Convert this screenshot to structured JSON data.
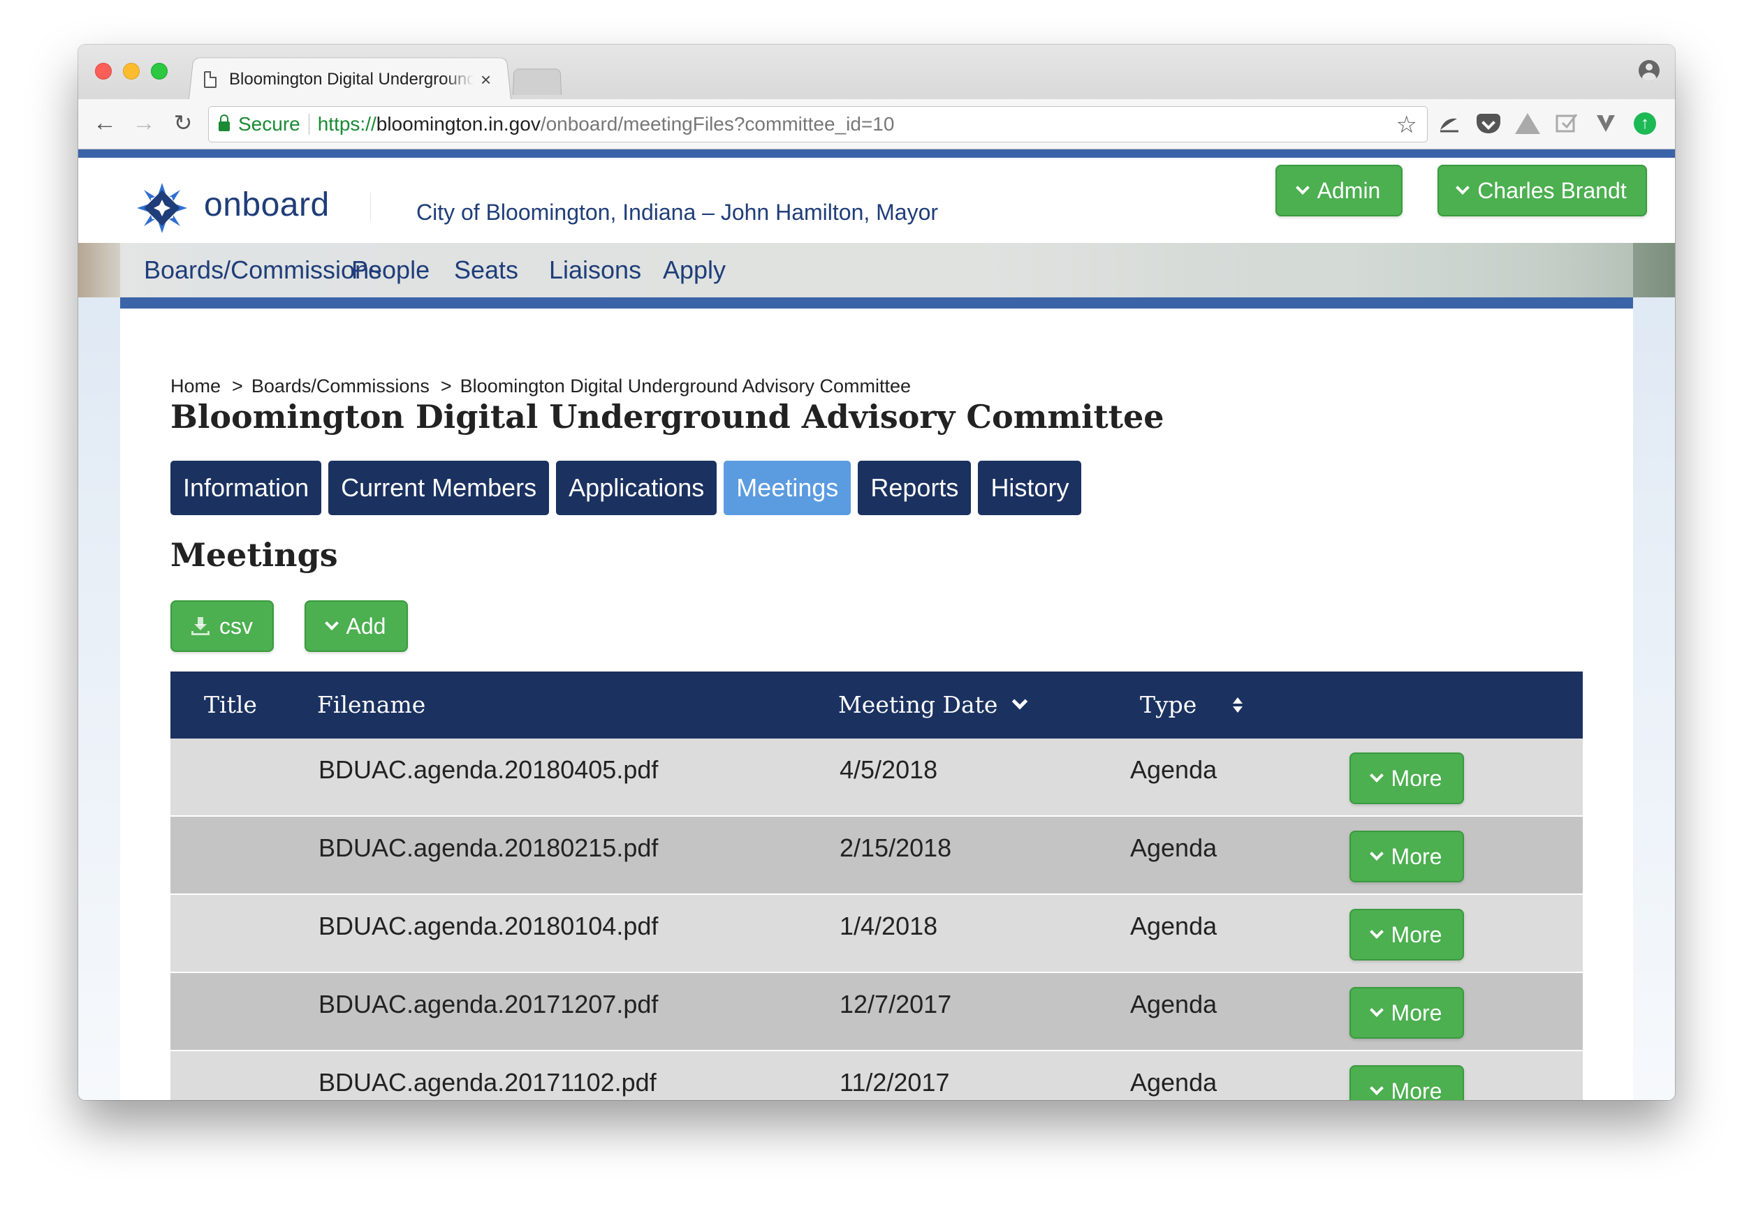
{
  "browser": {
    "tab_title": "Bloomington Digital Underground Advisory Committee",
    "tab_close": "×",
    "secure_label": "Secure",
    "url_scheme": "https://",
    "url_host": "bloomington.in.gov",
    "url_path": "/onboard/meetingFiles?committee_id=10",
    "back_glyph": "←",
    "forward_glyph": "→",
    "reload_glyph": "↻",
    "star_glyph": "☆",
    "extensions": [
      "weather-icon",
      "pocket-icon",
      "drive-icon",
      "save-icon",
      "vimeo-icon",
      "upload-icon"
    ]
  },
  "site": {
    "logo_text": "onboard",
    "city_title": "City of Bloomington, Indiana – John Hamilton, Mayor",
    "admin_label": "Admin",
    "user_label": "Charles Brandt",
    "brand_color": "#1f3d79",
    "accent_color": "#3b64a8",
    "button_color": "#4caf50"
  },
  "nav": {
    "items": [
      "Boards/Commissions",
      "People",
      "Seats",
      "Liaisons",
      "Apply"
    ]
  },
  "breadcrumb": {
    "items": [
      "Home",
      "Boards/Commissions",
      "Bloomington Digital Underground Advisory Committee"
    ],
    "separator": ">"
  },
  "page": {
    "title": "Bloomington Digital Underground Advisory Committee",
    "section_title": "Meetings",
    "csv_label": "csv",
    "add_label": "Add"
  },
  "tabs": {
    "items": [
      "Information",
      "Current Members",
      "Applications",
      "Meetings",
      "Reports",
      "History"
    ],
    "active": "Meetings"
  },
  "table": {
    "headers": {
      "title": "Title",
      "filename": "Filename",
      "meeting_date": "Meeting Date",
      "type": "Type"
    },
    "more_label": "More",
    "rows": [
      {
        "title": "",
        "filename": "BDUAC.agenda.20180405.pdf",
        "date": "4/5/2018",
        "type": "Agenda"
      },
      {
        "title": "",
        "filename": "BDUAC.agenda.20180215.pdf",
        "date": "2/15/2018",
        "type": "Agenda"
      },
      {
        "title": "",
        "filename": "BDUAC.agenda.20180104.pdf",
        "date": "1/4/2018",
        "type": "Agenda"
      },
      {
        "title": "",
        "filename": "BDUAC.agenda.20171207.pdf",
        "date": "12/7/2017",
        "type": "Agenda"
      },
      {
        "title": "",
        "filename": "BDUAC.agenda.20171102.pdf",
        "date": "11/2/2017",
        "type": "Agenda"
      }
    ]
  }
}
